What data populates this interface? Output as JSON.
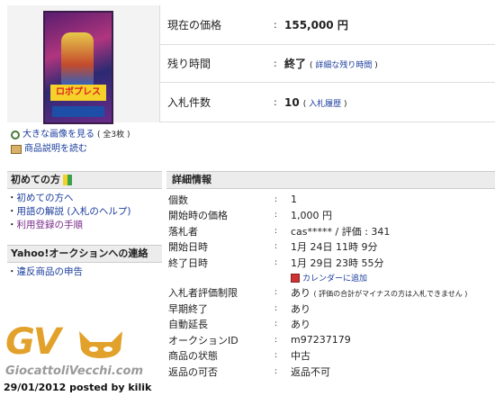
{
  "summary": {
    "current_price_label": "現在の価格",
    "current_price_value": "155,000 円",
    "time_left_label": "残り時間",
    "time_left_value": "終了",
    "time_left_link": "詳細な残り時間",
    "bids_label": "入札件数",
    "bids_value": "10",
    "bids_link": "入札履歴"
  },
  "image_links": {
    "large_image": "大きな画像を見る",
    "large_image_count": "( 全3枚 )",
    "read_description": "商品説明を読む"
  },
  "photo": {
    "box_text": "ロボプレス"
  },
  "sidebar": {
    "beginners_title": "初めての方",
    "beginners_items": [
      {
        "label": "初めての方へ"
      },
      {
        "label": "用語の解説 (入札のヘルプ)"
      },
      {
        "label": "利用登録の手順"
      }
    ],
    "contact_title": "Yahoo!オークションへの連絡",
    "contact_items": [
      {
        "label": "違反商品の申告"
      }
    ]
  },
  "details": {
    "title": "詳細情報",
    "rows": [
      {
        "label": "個数",
        "value": "1"
      },
      {
        "label": "開始時の価格",
        "value": "1,000 円"
      },
      {
        "label": "落札者",
        "value": "cas***** / 評価 : 341"
      },
      {
        "label": "開始日時",
        "value": "1月 24日 11時 9分"
      },
      {
        "label": "終了日時",
        "value": "1月 29日 23時 55分"
      }
    ],
    "calendar_link": "カレンダーに追加",
    "rows2": [
      {
        "label": "入札者評価制限",
        "value": "あり",
        "note": "( 評価の合計がマイナスの方は入札できません )"
      },
      {
        "label": "早期終了",
        "value": "あり"
      },
      {
        "label": "自動延長",
        "value": "あり"
      },
      {
        "label": "オークションID",
        "value": "m97237179"
      },
      {
        "label": "商品の状態",
        "value": "中古"
      },
      {
        "label": "返品の可否",
        "value": "返品不可"
      }
    ],
    "separator": ":"
  },
  "watermark": {
    "logo_text": "GV",
    "site_name": "GiocattoliVecchi.com",
    "posted": "29/01/2012 posted by kilik"
  },
  "colors": {
    "link": "#1a3c9c",
    "header_bg": "#ececec",
    "logo": "#e2a12a"
  }
}
